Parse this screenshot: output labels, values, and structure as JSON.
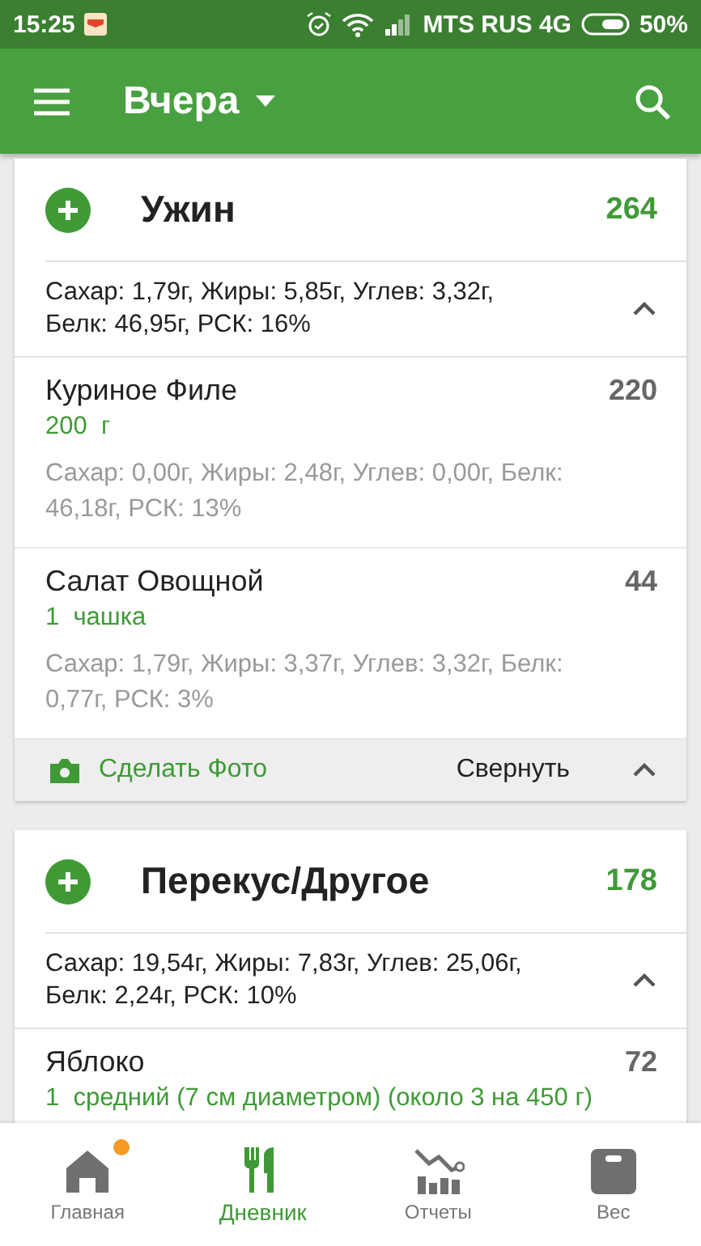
{
  "status_bar": {
    "time": "15:25",
    "carrier": "MTS RUS 4G",
    "battery": "50%"
  },
  "app_bar": {
    "title": "Вчера"
  },
  "meals": [
    {
      "name": "Ужин",
      "calories": "264",
      "summary": "Сахар: 1,79г, Жиры: 5,85г, Углев: 3,32г, Белк: 46,95г, РСК: 16%",
      "expanded": true,
      "items": [
        {
          "name": "Куриное Филе",
          "calories": "220",
          "serving": "200  г",
          "nutrients": "Сахар: 0,00г, Жиры: 2,48г, Углев: 0,00г, Белк: 46,18г, РСК: 13%"
        },
        {
          "name": "Салат Овощной",
          "calories": "44",
          "serving": "1  чашка",
          "nutrients": "Сахар: 1,79г, Жиры: 3,37г, Углев: 3,32г, Белк: 0,77г, РСК: 3%"
        }
      ],
      "footer": {
        "photo": "Сделать Фото",
        "collapse": "Свернуть"
      }
    },
    {
      "name": "Перекус/Другое",
      "calories": "178",
      "summary": "Сахар: 19,54г, Жиры: 7,83г, Углев: 25,06г, Белк: 2,24г, РСК: 10%",
      "expanded": true,
      "items": [
        {
          "name": "Яблоко",
          "calories": "72",
          "serving": "1  средний (7 см диаметром) (около 3 на 450 г)"
        }
      ]
    }
  ],
  "bottom_nav": [
    {
      "kind": "home",
      "label": "Главная",
      "selected": false,
      "badge": true
    },
    {
      "kind": "diary",
      "label": "Дневник",
      "selected": true,
      "badge": false
    },
    {
      "kind": "reports",
      "label": "Отчеты",
      "selected": false,
      "badge": false
    },
    {
      "kind": "weight",
      "label": "Вес",
      "selected": false,
      "badge": false
    }
  ]
}
